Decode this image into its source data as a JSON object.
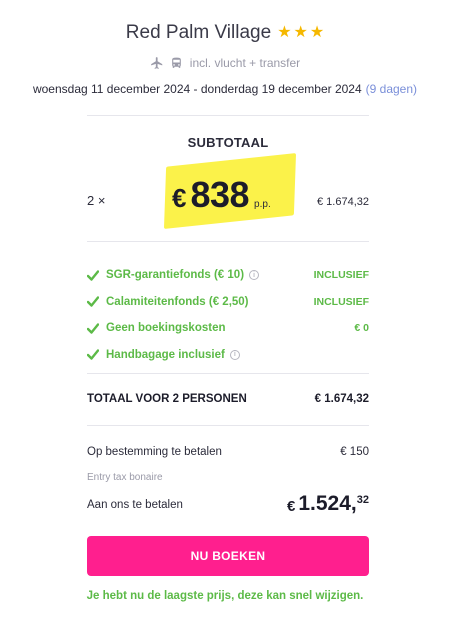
{
  "hotel": {
    "name": "Red Palm Village",
    "stars": 3,
    "star_color": "#f5b800"
  },
  "travel": {
    "icons": [
      "plane-icon",
      "bus-icon"
    ],
    "text": "incl. vlucht + transfer"
  },
  "dates": {
    "range": "woensdag 11 december 2024 - donderdag 19 december 2024",
    "duration": "(9 dagen)"
  },
  "summary": {
    "title": "SUBTOTAAL",
    "quantity": "2 ×",
    "currency": "€",
    "price_pp": "838",
    "pp_label": "p.p.",
    "subtotal": "€ 1.674,32",
    "highlight_color": "#fbf24a"
  },
  "inclusions": [
    {
      "label": "SGR-garantiefonds  (€ 10)",
      "info": true,
      "value": "INCLUSIEF"
    },
    {
      "label": "Calamiteitenfonds  (€ 2,50)",
      "info": false,
      "value": "INCLUSIEF"
    },
    {
      "label": "Geen boekingskosten",
      "info": false,
      "value": "€ 0"
    },
    {
      "label": "Handbagage inclusief",
      "info": true,
      "value": ""
    }
  ],
  "total": {
    "label": "TOTAAL VOOR 2 PERSONEN",
    "value": "€ 1.674,32"
  },
  "destination": {
    "label": "Op bestemming te betalen",
    "value": "€ 150",
    "note": "Entry tax bonaire"
  },
  "pay": {
    "label": "Aan ons te betalen",
    "currency": "€",
    "integer": "1.524,",
    "decimals": "32"
  },
  "cta": {
    "label": "NU BOEKEN",
    "color": "#ff1f8e"
  },
  "lowest_price": "Je hebt nu de laagste prijs, deze kan snel wijzigen.",
  "accent_green": "#5cba47"
}
